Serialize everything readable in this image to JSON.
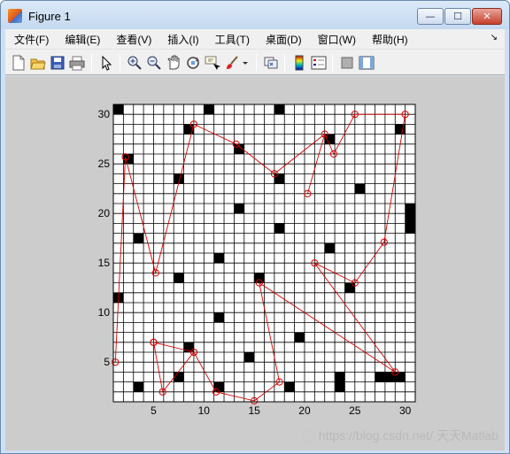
{
  "window": {
    "title": "Figure 1"
  },
  "menus": [
    "文件(F)",
    "编辑(E)",
    "查看(V)",
    "插入(I)",
    "工具(T)",
    "桌面(D)",
    "窗口(W)",
    "帮助(H)"
  ],
  "toolbar": [
    "new-figure-icon",
    "open-icon",
    "save-icon",
    "print-icon",
    "pointer-icon",
    "zoom-in-icon",
    "zoom-out-icon",
    "pan-icon",
    "rotate-3d-icon",
    "data-cursor-icon",
    "brush-icon",
    "link-icon",
    "colorbar-icon",
    "legend-icon",
    "hide-plot-tools-icon",
    "show-plot-tools-icon"
  ],
  "chart_data": {
    "type": "scatter",
    "title": "",
    "xlabel": "",
    "ylabel": "",
    "xlim": [
      1,
      31
    ],
    "ylim": [
      1,
      31
    ],
    "xticks": [
      5,
      10,
      15,
      20,
      25,
      30
    ],
    "yticks": [
      5,
      10,
      15,
      20,
      25,
      30
    ],
    "grid": "unit cell grid",
    "obstacle_color": "#000000",
    "route_color": "#d40000",
    "obstacles": [
      [
        1,
        30
      ],
      [
        10,
        30
      ],
      [
        17,
        30
      ],
      [
        8,
        28
      ],
      [
        29,
        28
      ],
      [
        22,
        27
      ],
      [
        13,
        26
      ],
      [
        2,
        25
      ],
      [
        7,
        23
      ],
      [
        17,
        23
      ],
      [
        25,
        22
      ],
      [
        13,
        20
      ],
      [
        30,
        20
      ],
      [
        30,
        19
      ],
      [
        17,
        18
      ],
      [
        30,
        18
      ],
      [
        3,
        17
      ],
      [
        22,
        16
      ],
      [
        11,
        15
      ],
      [
        7,
        13
      ],
      [
        15,
        13
      ],
      [
        24,
        12
      ],
      [
        1,
        11
      ],
      [
        11,
        9
      ],
      [
        19,
        7
      ],
      [
        8,
        6
      ],
      [
        14,
        5
      ],
      [
        7,
        3
      ],
      [
        23,
        3
      ],
      [
        27,
        3
      ],
      [
        28,
        3
      ],
      [
        29,
        3
      ],
      [
        3,
        2
      ],
      [
        11,
        2
      ],
      [
        18,
        2
      ],
      [
        23,
        2
      ]
    ],
    "route_points": [
      [
        1.2,
        5
      ],
      [
        2.2,
        25.7
      ],
      [
        5.2,
        14
      ],
      [
        9.0,
        29
      ],
      [
        13.2,
        27
      ],
      [
        17.0,
        24
      ],
      [
        22.0,
        28
      ],
      [
        22.9,
        26
      ],
      [
        25.0,
        30
      ],
      [
        30.0,
        30
      ],
      [
        27.9,
        17.1
      ],
      [
        25.0,
        13
      ],
      [
        21.0,
        15
      ],
      [
        29.0,
        4
      ],
      [
        15.5,
        13
      ],
      [
        17.5,
        3
      ],
      [
        15.0,
        1.1
      ],
      [
        11.2,
        2
      ],
      [
        9.0,
        6
      ],
      [
        5.0,
        7
      ],
      [
        5.9,
        2
      ],
      [
        9.0,
        6
      ],
      [
        5.0,
        7
      ]
    ],
    "extra_link": [
      [
        20.3,
        22
      ],
      [
        22.0,
        28
      ]
    ]
  },
  "watermark": "https://blog.csdn.net/  天天Matlab"
}
